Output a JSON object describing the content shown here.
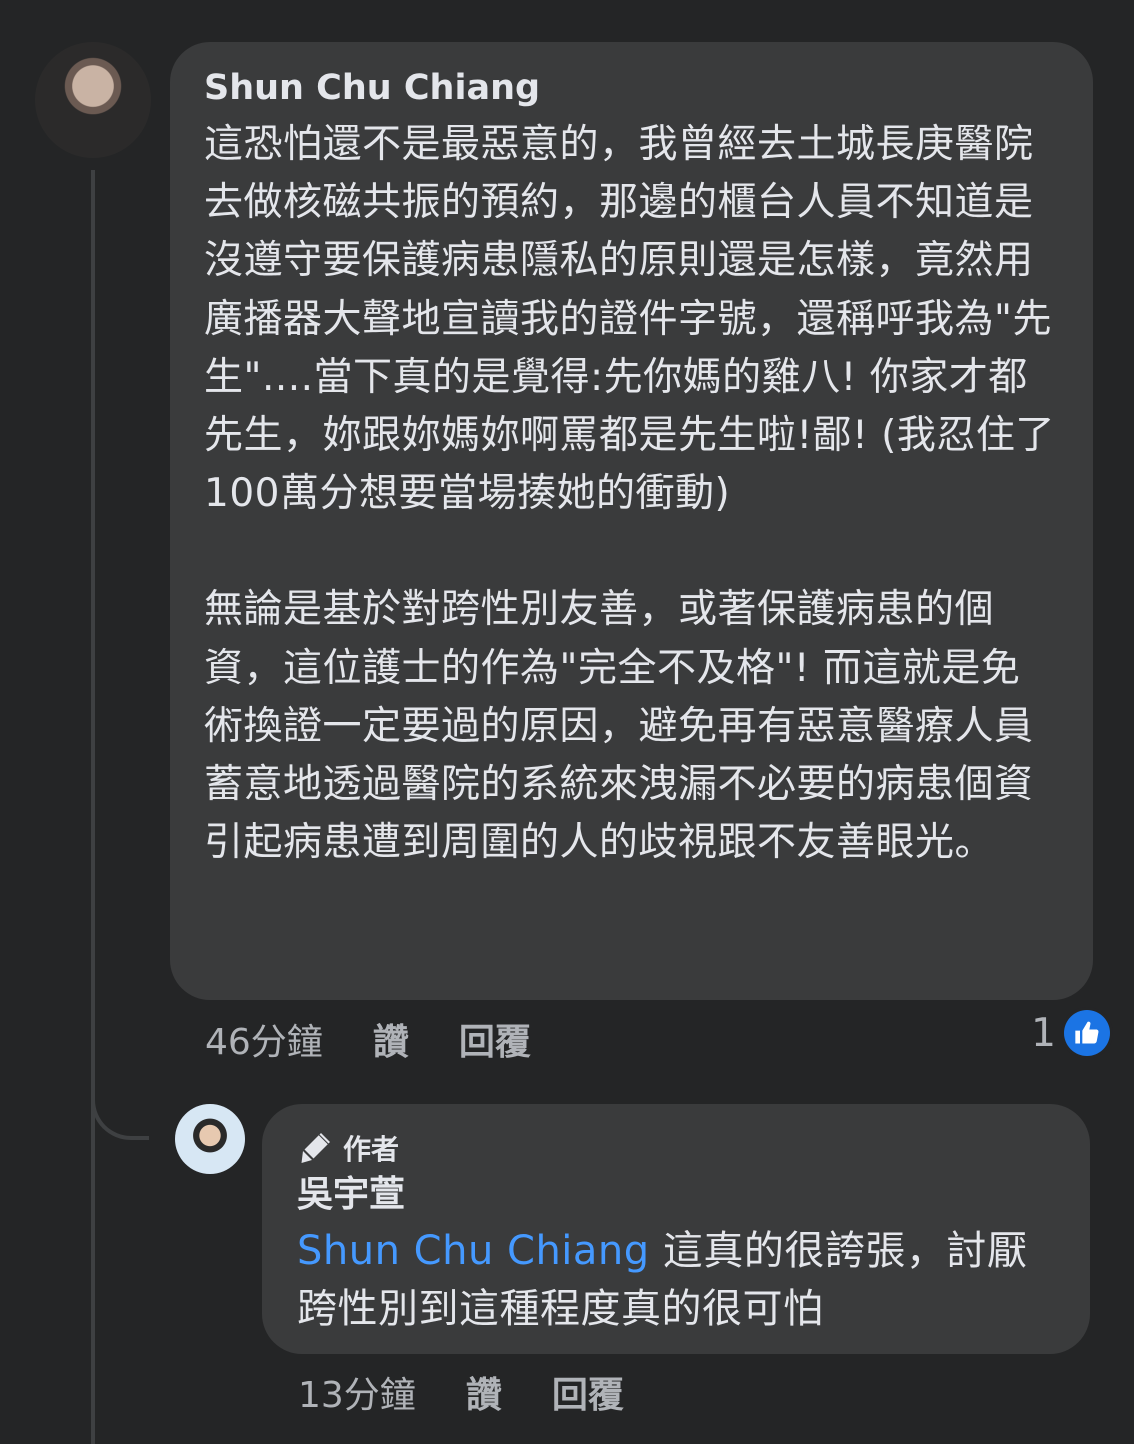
{
  "main_comment": {
    "author": "Shun Chu Chiang",
    "paragraph_1": "這恐怕還不是最惡意的，我曾經去土城長庚醫院去做核磁共振的預約，那邊的櫃台人員不知道是沒遵守要保護病患隱私的原則還是怎樣，竟然用廣播器大聲地宣讀我的證件字號，還稱呼我為\"先生\"....當下真的是覺得:先你媽的雞八! 你家才都先生，妳跟妳媽妳啊罵都是先生啦!鄙! (我忍住了100萬分想要當場揍她的衝動)",
    "paragraph_2": "無論是基於對跨性別友善，或著保護病患的個資，這位護士的作為\"完全不及格\"! 而這就是免術換證一定要過的原因，避免再有惡意醫療人員蓄意地透過醫院的系統來洩漏不必要的病患個資引起病患遭到周圍的人的歧視跟不友善眼光。",
    "time": "46分鐘",
    "like_label": "讚",
    "reply_label": "回覆",
    "reaction_count": "1"
  },
  "reply_comment": {
    "badge": "作者",
    "author": "吳宇萱",
    "mention": "Shun Chu Chiang",
    "text": " 這真的很誇張，討厭跨性別到這種程度真的很可怕",
    "time": "13分鐘",
    "like_label": "讚",
    "reply_label": "回覆"
  },
  "colors": {
    "background": "#242526",
    "bubble": "#3a3b3c",
    "text": "#e4e6eb",
    "secondary_text": "#b0b3b8",
    "mention": "#4599ff",
    "like_blue": "#1b74e4"
  },
  "icons": {
    "like": "thumbs-up-icon",
    "author_badge": "pen-icon"
  }
}
